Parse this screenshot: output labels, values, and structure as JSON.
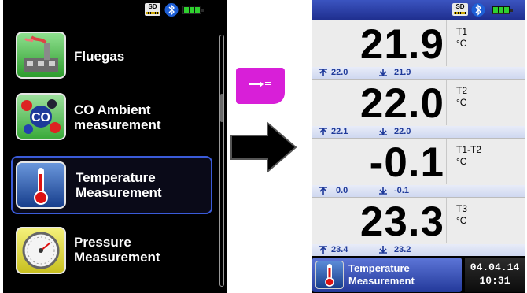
{
  "left_screen": {
    "status": {
      "sd": "SD",
      "bluetooth_icon": "bluetooth-icon",
      "battery_icon": "battery-full-icon"
    },
    "menu_items": [
      {
        "label_lines": [
          "Fluegas"
        ],
        "icon": "factory-chimney-icon",
        "selected": false
      },
      {
        "label_lines": [
          "CO Ambient",
          "measurement"
        ],
        "icon": "co-molecule-icon",
        "selected": false
      },
      {
        "label_lines": [
          "Temperature",
          "Measurement"
        ],
        "icon": "thermometer-icon",
        "selected": true
      },
      {
        "label_lines": [
          "Pressure",
          "Measurement"
        ],
        "icon": "pressure-gauge-icon",
        "selected": false
      }
    ]
  },
  "middle": {
    "key_button_icon": "enter-list-icon",
    "transition_arrow_icon": "right-arrow-icon"
  },
  "right_screen": {
    "status": {
      "sd": "SD",
      "bluetooth_icon": "bluetooth-icon",
      "battery_icon": "battery-full-icon"
    },
    "readings": [
      {
        "value": "21.9",
        "name": "T1",
        "unit": "°C",
        "max": "22.0",
        "min": "21.9"
      },
      {
        "value": "22.0",
        "name": "T2",
        "unit": "°C",
        "max": "22.1",
        "min": "22.0"
      },
      {
        "value": "-0.1",
        "name": "T1-T2",
        "unit": "°C",
        "max": "0.0",
        "min": "-0.1"
      },
      {
        "value": "23.3",
        "name": "T3",
        "unit": "°C",
        "max": "23.4",
        "min": "23.2"
      }
    ],
    "bottom_bar": {
      "mode_lines": [
        "Temperature",
        "Measurement"
      ],
      "mode_icon": "thermometer-icon",
      "date": "04.04.14",
      "time": "10:31"
    }
  },
  "colors": {
    "accent_magenta": "#d81fd8",
    "selection_blue": "#3a5bd9",
    "header_blue": "#2a3fa8",
    "minmax_text": "#1f3a9a",
    "battery_green": "#2fd12f"
  }
}
